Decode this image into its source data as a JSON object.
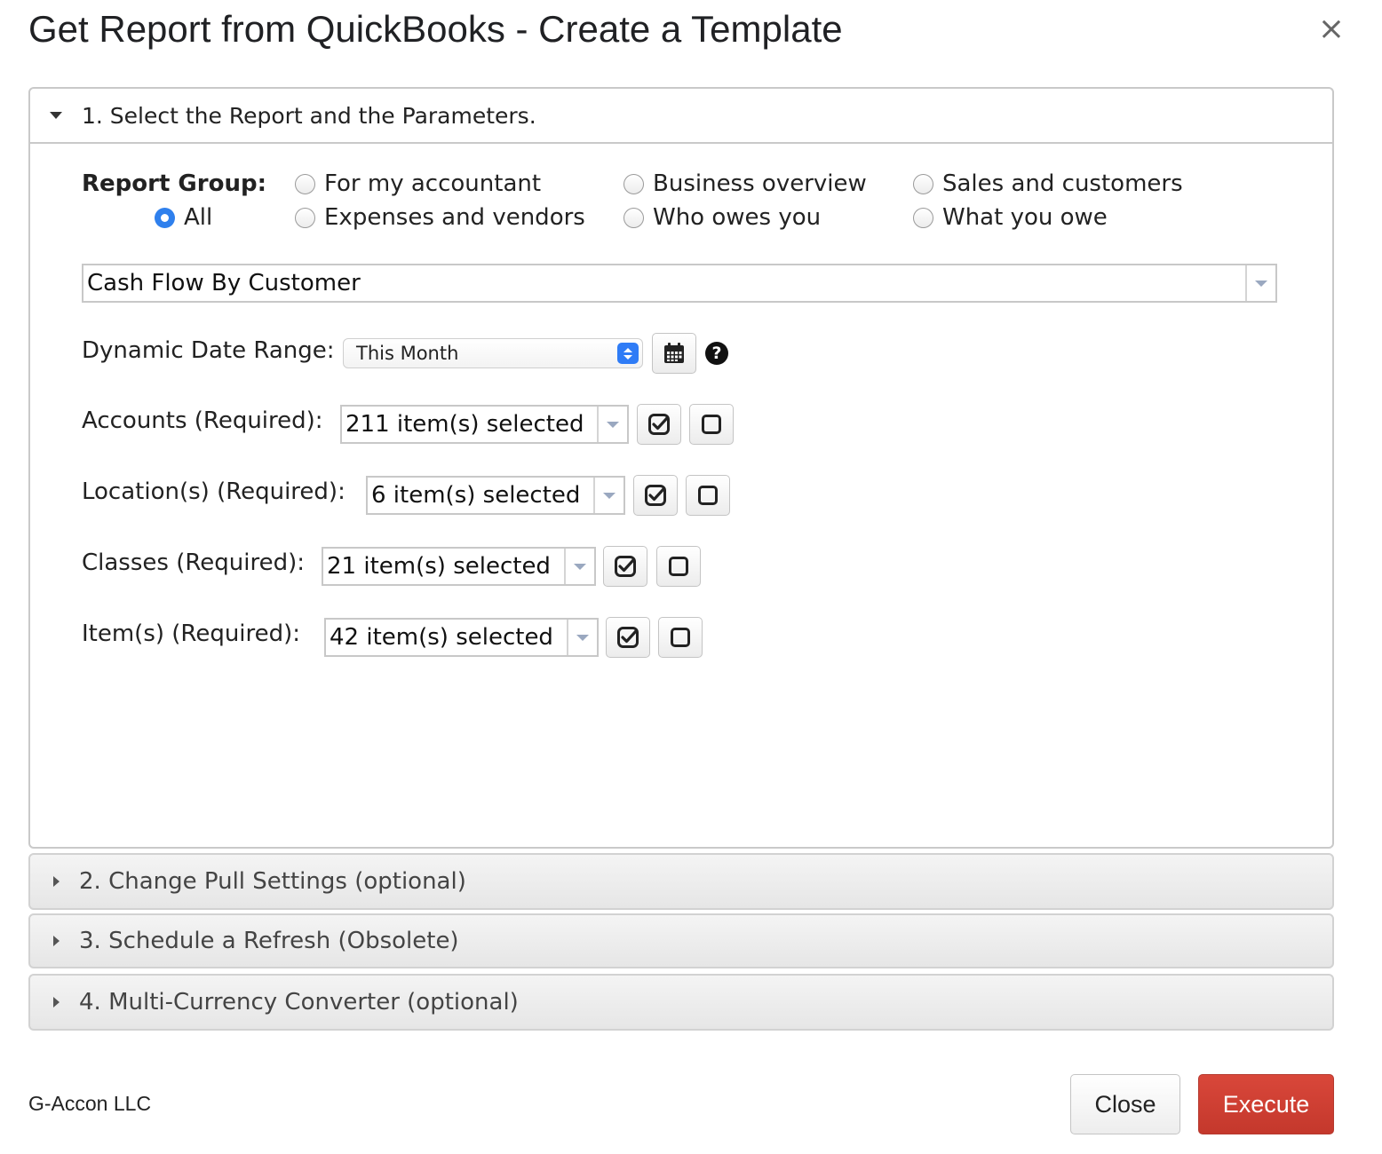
{
  "dialog": {
    "title": "Get Report from QuickBooks - Create a Template",
    "close_icon": "×"
  },
  "section1": {
    "header": "1. Select the Report and the Parameters.",
    "report_group": {
      "label": "Report Group:",
      "options": [
        "All",
        "For my accountant",
        "Expenses and vendors",
        "Business overview",
        "Who owes you",
        "Sales and customers",
        "What you owe"
      ],
      "selected": "All"
    },
    "report": {
      "value": "Cash Flow By Customer"
    },
    "date_range": {
      "label": "Dynamic Date Range:",
      "value": "This Month",
      "help": "?"
    },
    "fields": [
      {
        "label": "Accounts (Required):",
        "value": "211 item(s) selected"
      },
      {
        "label": "Location(s) (Required):",
        "value": "6 item(s) selected"
      },
      {
        "label": "Classes (Required):",
        "value": "21 item(s) selected"
      },
      {
        "label": "Item(s) (Required):",
        "value": "42 item(s) selected"
      }
    ]
  },
  "sections": [
    {
      "header": "2. Change Pull Settings (optional)"
    },
    {
      "header": "3. Schedule a Refresh (Obsolete)"
    },
    {
      "header": "4. Multi-Currency Converter (optional)"
    }
  ],
  "footer": {
    "company": "G-Accon LLC",
    "close_label": "Close",
    "execute_label": "Execute"
  },
  "colors": {
    "execute": "#c9392d",
    "radio_selected": "#2f80ed"
  },
  "icons": {
    "calendar": "calendar-icon",
    "check_all": "check-square-icon",
    "uncheck_all": "empty-square-icon"
  }
}
